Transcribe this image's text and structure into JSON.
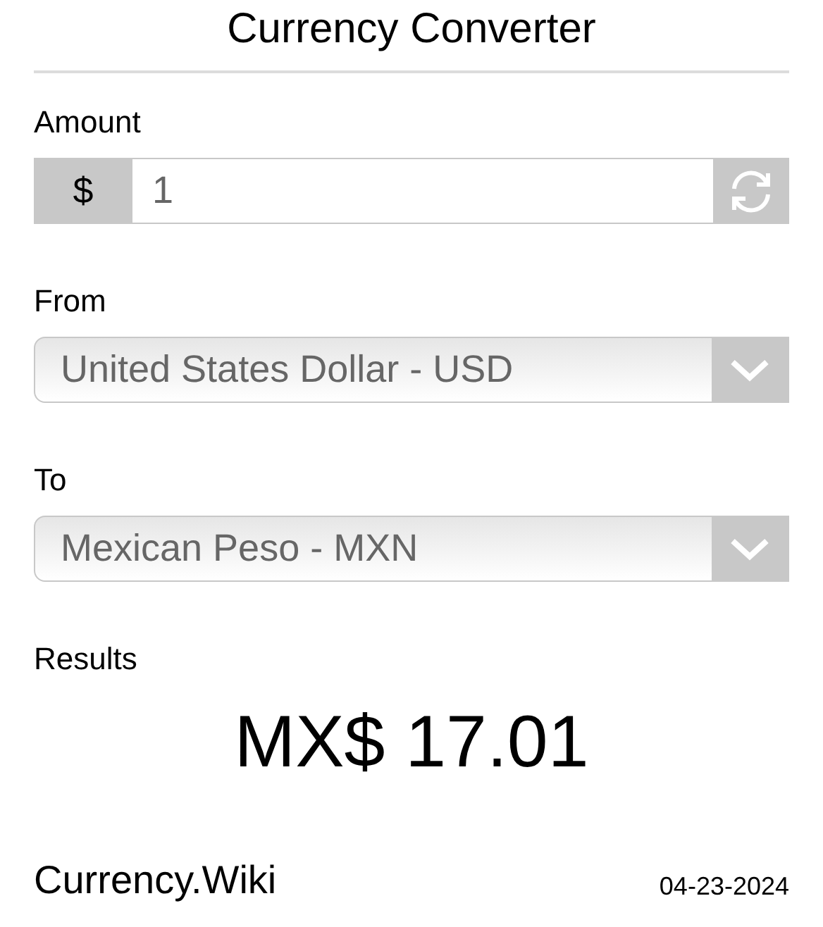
{
  "title": "Currency Converter",
  "amount": {
    "label": "Amount",
    "symbol": "$",
    "value": "1"
  },
  "from": {
    "label": "From",
    "value": "United States Dollar - USD"
  },
  "to": {
    "label": "To",
    "value": "Mexican Peso - MXN"
  },
  "results": {
    "label": "Results",
    "value": "MX$ 17.01"
  },
  "footer": {
    "brand": "Currency.Wiki",
    "date": "04-23-2024"
  }
}
